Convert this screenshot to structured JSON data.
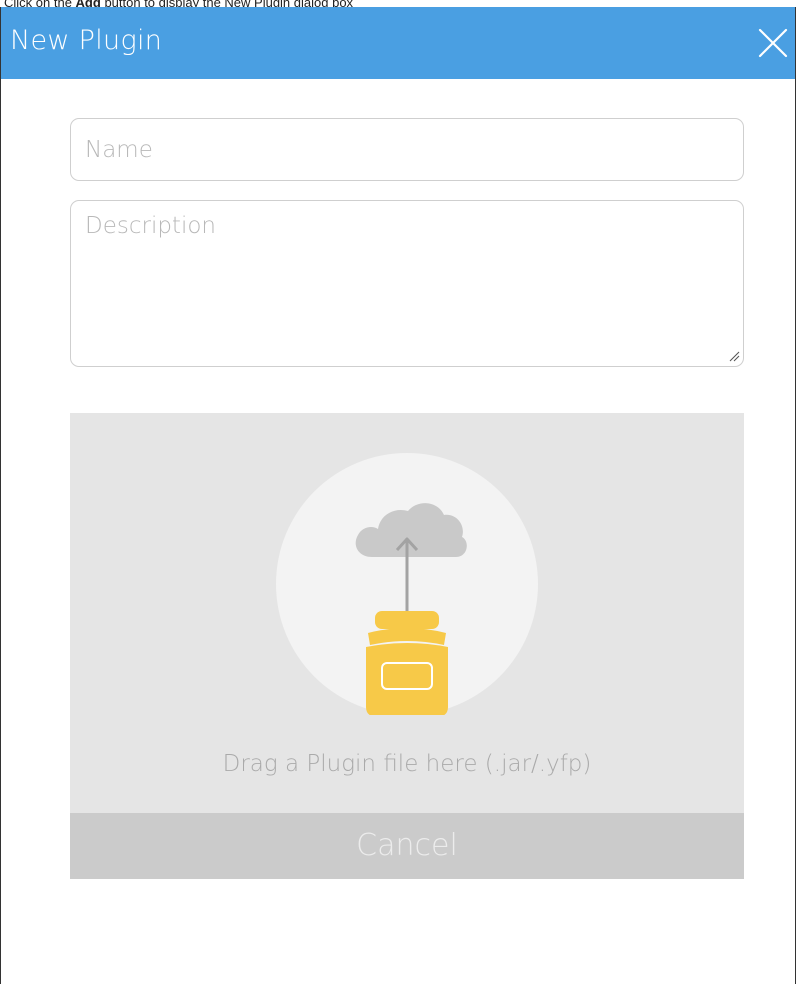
{
  "caption": {
    "prefix": "Click on the ",
    "bold": "Add",
    "suffix": " button to display the New Plugin dialog box"
  },
  "dialog": {
    "title": "New Plugin",
    "close_icon": "close-icon",
    "name_placeholder": "Name",
    "description_placeholder": "Description",
    "dropzone": {
      "icon": "plugin-upload-icon",
      "text": "Drag a Plugin file here (.jar/.yfp)"
    },
    "cancel_label": "Cancel"
  },
  "colors": {
    "header": "#4a9fe2",
    "jar": "#f7c948",
    "cloud": "#c9c9c9",
    "dropzone": "#e5e5e5",
    "cancel": "#cbcbcb"
  }
}
